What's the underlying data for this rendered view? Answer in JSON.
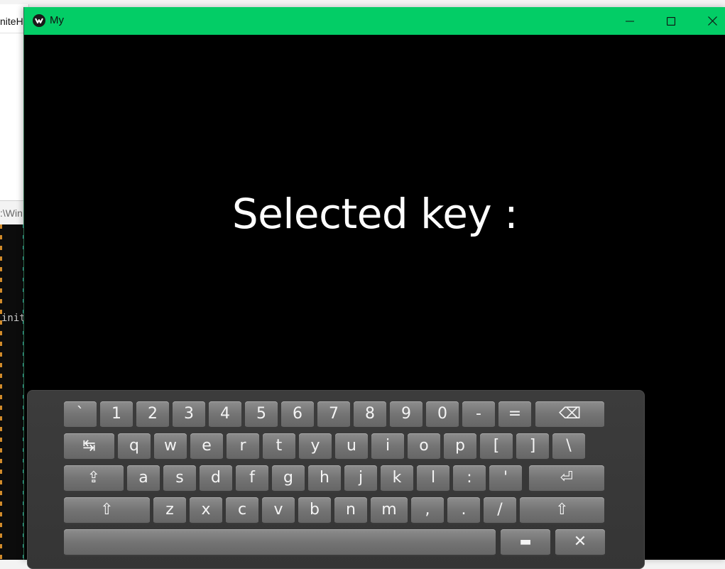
{
  "background": {
    "window_title_fragment": "niteHa",
    "terminal_path_fragment": ":\\Win",
    "terminal_text_fragment": "init"
  },
  "window": {
    "title": "My",
    "title_bar_color": "#03cd66",
    "minimize_icon": "minimize-icon",
    "maximize_icon": "maximize-icon",
    "close_icon": "close-icon"
  },
  "main": {
    "selected_key_label": "Selected key :"
  },
  "keyboard": {
    "rows": [
      [
        "`",
        "1",
        "2",
        "3",
        "4",
        "5",
        "6",
        "7",
        "8",
        "9",
        "0",
        "-",
        "=",
        "⌫"
      ],
      [
        "↹",
        "q",
        "w",
        "e",
        "r",
        "t",
        "y",
        "u",
        "i",
        "o",
        "p",
        "[",
        "]",
        "\\"
      ],
      [
        "⇪",
        "a",
        "s",
        "d",
        "f",
        "g",
        "h",
        "j",
        "k",
        "l",
        ":",
        "'",
        "⏎"
      ],
      [
        "⇧",
        "z",
        "x",
        "c",
        "v",
        "b",
        "n",
        "m",
        ",",
        ".",
        "/",
        "⇧"
      ],
      [
        "",
        "▬",
        "✕"
      ]
    ],
    "special_key_names": {
      "backspace": "backspace-icon",
      "tab": "tab-icon",
      "capslock": "capslock-icon",
      "enter": "enter-icon",
      "shift": "shift-icon",
      "layout": "layout-icon",
      "close": "close-keyboard-icon"
    }
  }
}
